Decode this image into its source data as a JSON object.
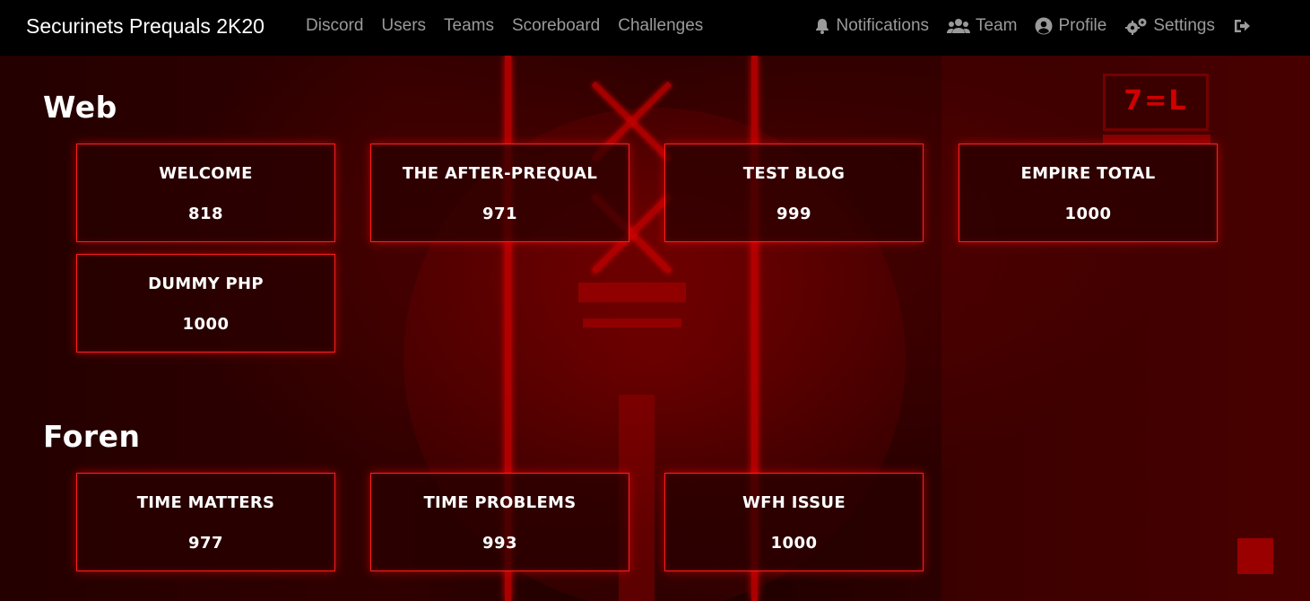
{
  "navbar": {
    "brand": "Securinets Prequals 2K20",
    "links": [
      "Discord",
      "Users",
      "Teams",
      "Scoreboard",
      "Challenges"
    ],
    "right": [
      {
        "label": "Notifications",
        "icon": "bell-icon"
      },
      {
        "label": "Team",
        "icon": "users-icon"
      },
      {
        "label": "Profile",
        "icon": "user-circle-icon"
      },
      {
        "label": "Settings",
        "icon": "gears-icon"
      },
      {
        "label": "",
        "icon": "logout-icon"
      }
    ]
  },
  "categories": [
    {
      "name": "Web",
      "challenges": [
        {
          "name": "WELCOME",
          "points": "818"
        },
        {
          "name": "THE AFTER-PREQUAL",
          "points": "971"
        },
        {
          "name": "TEST BLOG",
          "points": "999"
        },
        {
          "name": "EMPIRE TOTAL",
          "points": "1000"
        },
        {
          "name": "DUMMY PHP",
          "points": "1000"
        }
      ]
    },
    {
      "name": "Foren",
      "challenges": [
        {
          "name": "TIME MATTERS",
          "points": "977"
        },
        {
          "name": "TIME PROBLEMS",
          "points": "993"
        },
        {
          "name": "WFH ISSUE",
          "points": "1000"
        }
      ]
    }
  ],
  "background_sign": "7=L",
  "colors": {
    "accent": "#ff2020",
    "navbar": "#000000",
    "nav_text": "#9a9a9a"
  }
}
